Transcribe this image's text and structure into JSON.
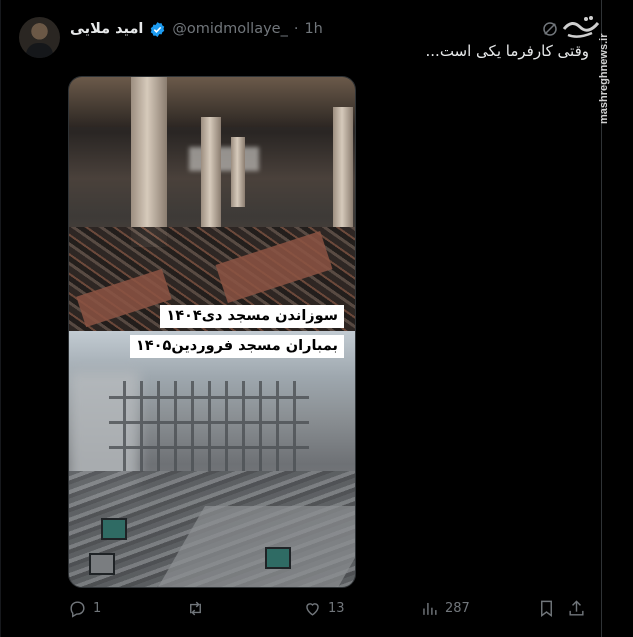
{
  "post": {
    "author_name": "امید ملایی",
    "handle": "@omidmollaye_",
    "separator": "·",
    "time": "1h",
    "text": "وقتی کارفرما یکی است..."
  },
  "media": {
    "caption_top": "سوزاندن مسجد دی۱۴۰۴",
    "caption_bottom": "بمباران مسجد فروردین۱۴۰۵"
  },
  "watermark": {
    "logo_text": "مشرق",
    "url": "mashreghnews.ir"
  },
  "actions": {
    "reply_icon": "reply-icon",
    "reply_count": "1",
    "repost_icon": "repost-icon",
    "repost_count": "",
    "like_icon": "heart-icon",
    "like_count": "13",
    "views_icon": "views-icon",
    "views_count": "287",
    "bookmark_icon": "bookmark-icon",
    "share_icon": "share-icon"
  },
  "colors": {
    "background": "#000000",
    "text": "#e7e9ea",
    "muted": "#71767b",
    "verified": "#1d9bf0",
    "border": "#2f3336"
  }
}
